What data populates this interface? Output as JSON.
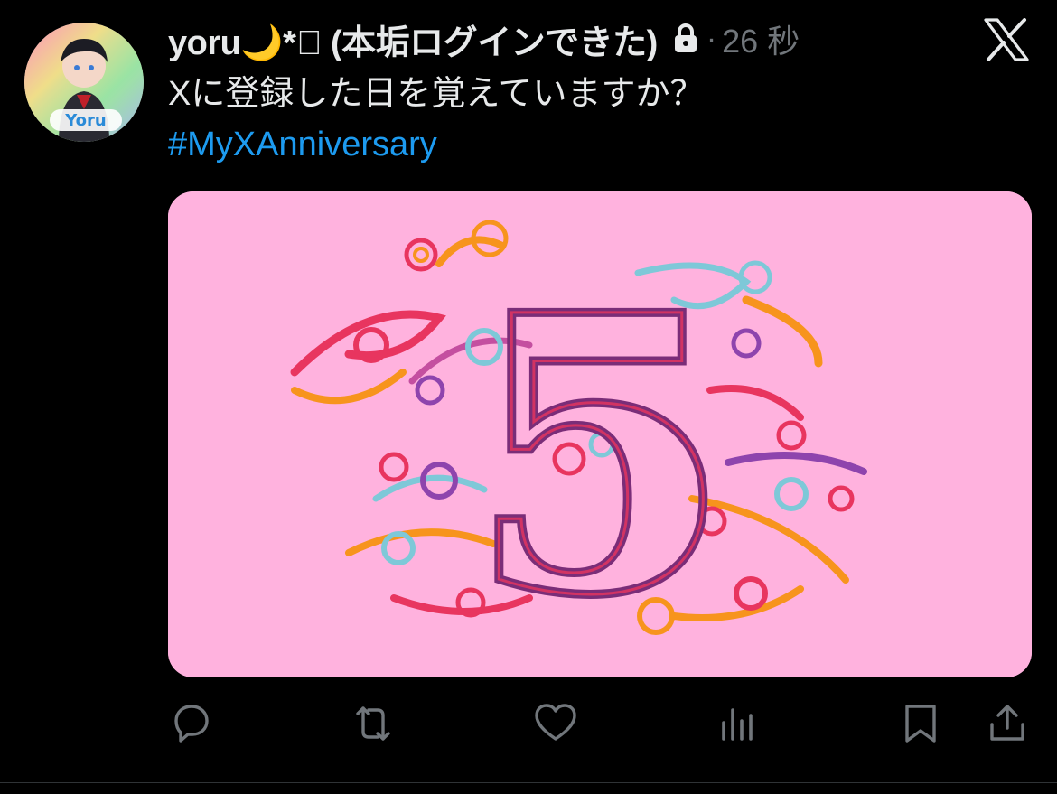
{
  "tweet": {
    "display_name": "yoru🌙*゚ (本垢ログインできた)",
    "dot": "·",
    "time": "26 秒",
    "text": "Xに登録した日を覚えていますか？",
    "hashtag": "#MyXAnniversary"
  },
  "avatar": {
    "caption": "Yoru"
  },
  "media": {
    "big_numeral": "5",
    "colors": [
      "#ffb2de",
      "#e8355f",
      "#f7941d",
      "#7ec8d8",
      "#8e44ad"
    ]
  },
  "icons": {
    "lock": "lock-icon",
    "x_logo": "x-logo-icon",
    "reply": "reply-icon",
    "repost": "repost-icon",
    "like": "like-icon",
    "views": "views-icon",
    "bookmark": "bookmark-icon",
    "share": "share-icon"
  },
  "colors": {
    "background": "#000000",
    "text": "#e7e9ea",
    "secondary": "#71767b",
    "link": "#1d9bf0",
    "media_bg": "#ffb2de"
  }
}
